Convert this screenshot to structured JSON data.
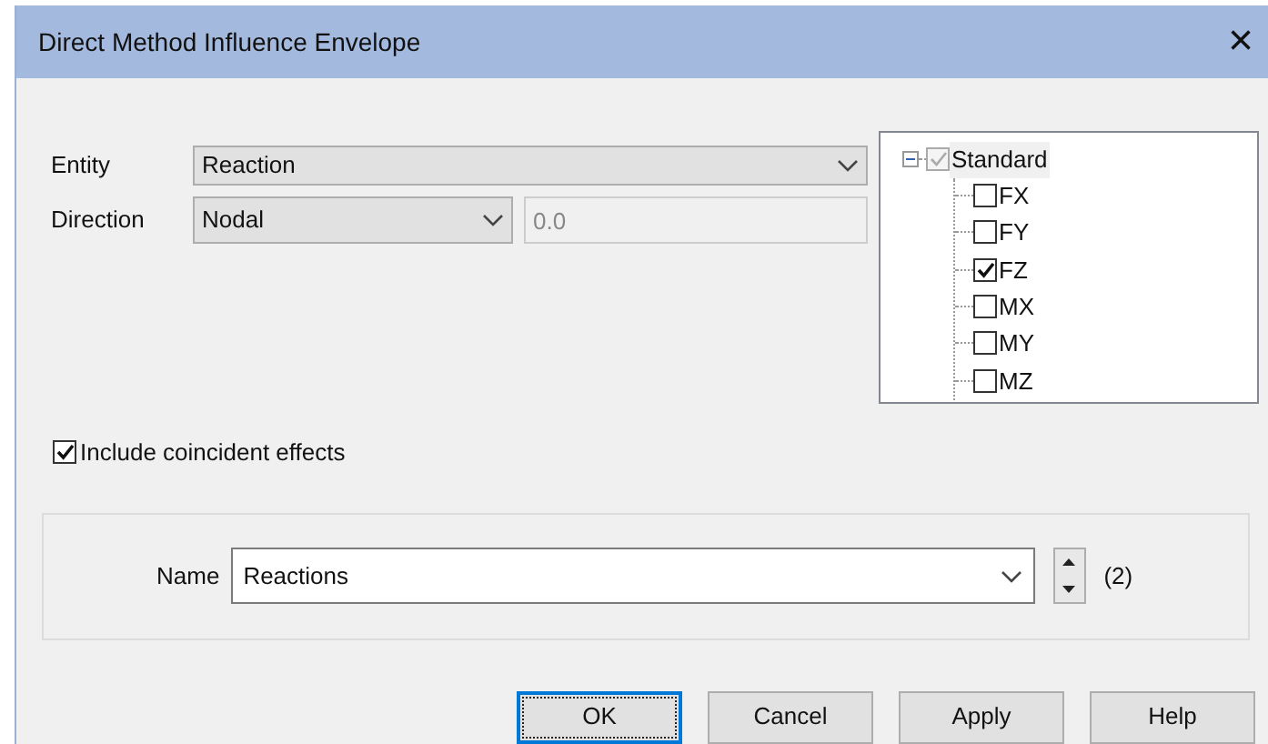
{
  "window": {
    "title": "Direct Method Influence Envelope",
    "close": "×"
  },
  "entity": {
    "label": "Entity",
    "value": "Reaction"
  },
  "direction": {
    "label": "Direction",
    "value": "Nodal",
    "offset_placeholder": "0.0"
  },
  "tree": {
    "label": "Standard",
    "expanded": true,
    "checked": true,
    "mixed": true,
    "children": [
      {
        "label": "FX",
        "checked": false
      },
      {
        "label": "FY",
        "checked": false
      },
      {
        "label": "FZ",
        "checked": true
      },
      {
        "label": "MX",
        "checked": false
      },
      {
        "label": "MY",
        "checked": false
      },
      {
        "label": "MZ",
        "checked": false
      }
    ]
  },
  "include_coincident": {
    "label": "Include coincident effects",
    "checked": true
  },
  "name": {
    "label": "Name",
    "value": "Reactions",
    "count": "(2)"
  },
  "buttons": [
    {
      "label": "OK",
      "default": true
    },
    {
      "label": "Cancel",
      "default": false
    },
    {
      "label": "Apply",
      "default": false
    },
    {
      "label": "Help",
      "default": false
    }
  ]
}
